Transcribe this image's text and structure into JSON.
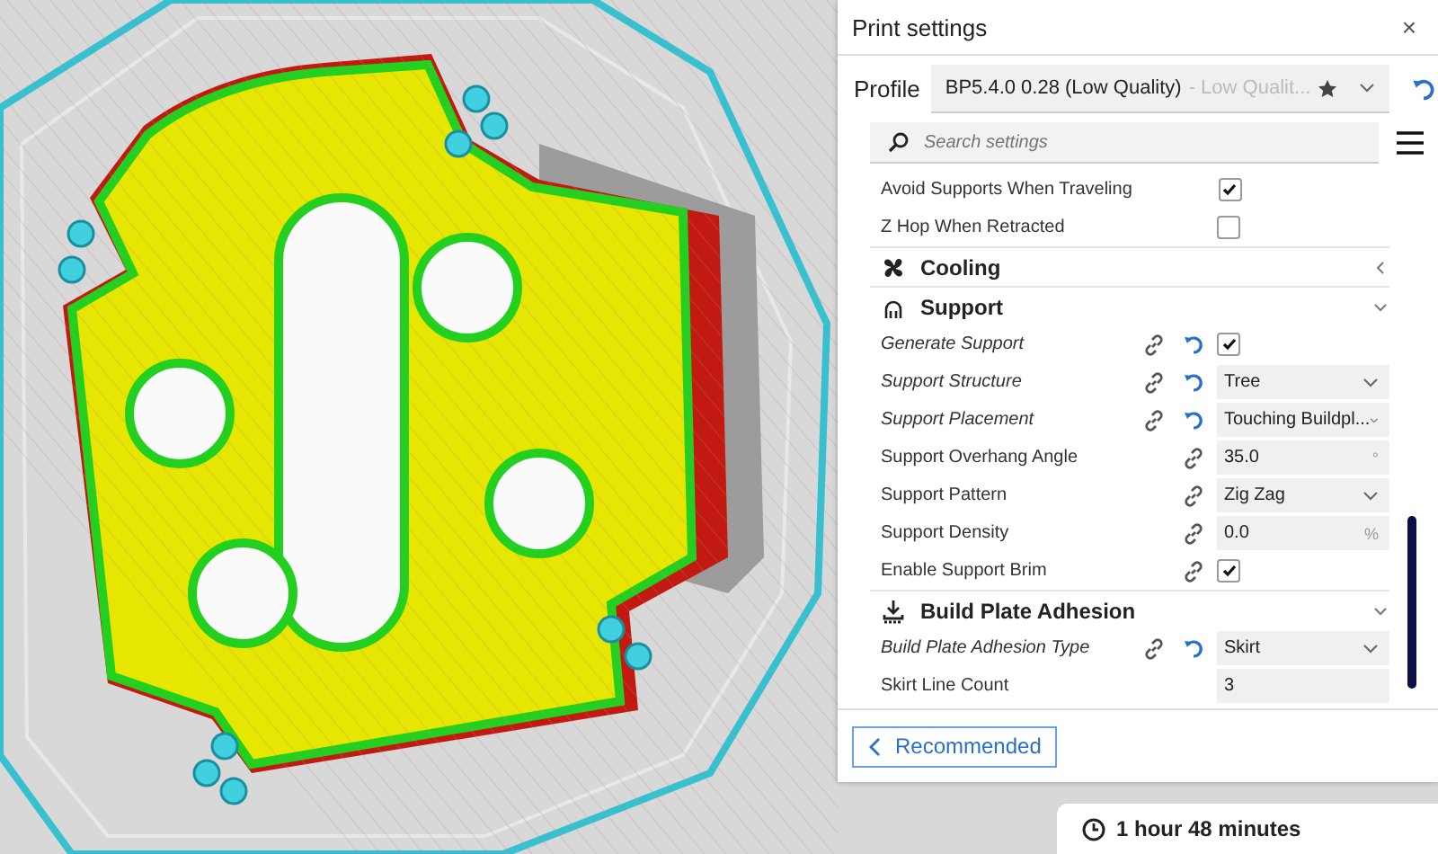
{
  "panel": {
    "title": "Print settings",
    "close": "×"
  },
  "profile": {
    "label": "Profile",
    "value": "BP5.4.0 0.28 (Low Quality)",
    "suffix": "- Low Qualit..."
  },
  "search": {
    "placeholder": "Search settings"
  },
  "settings": [
    {
      "kind": "checkbox",
      "label": "Avoid Supports When Traveling",
      "checked": true,
      "modified": false,
      "linked": false
    },
    {
      "kind": "checkbox",
      "label": "Z Hop When Retracted",
      "checked": false,
      "modified": false,
      "linked": false
    },
    {
      "kind": "section",
      "label": "Cooling",
      "expanded": false
    },
    {
      "kind": "section",
      "label": "Support",
      "expanded": true
    },
    {
      "kind": "checkbox",
      "label": "Generate Support",
      "checked": true,
      "modified": true,
      "linked": true
    },
    {
      "kind": "dropdown",
      "label": "Support Structure",
      "value": "Tree",
      "modified": true,
      "linked": true
    },
    {
      "kind": "dropdown",
      "label": "Support Placement",
      "value": "Touching Buildpl...",
      "modified": true,
      "linked": true
    },
    {
      "kind": "number",
      "label": "Support Overhang Angle",
      "value": "35.0",
      "unit": "°",
      "modified": false,
      "linked": true
    },
    {
      "kind": "dropdown",
      "label": "Support Pattern",
      "value": "Zig Zag",
      "modified": false,
      "linked": true
    },
    {
      "kind": "number",
      "label": "Support Density",
      "value": "0.0",
      "unit": "%",
      "modified": false,
      "linked": true
    },
    {
      "kind": "checkbox",
      "label": "Enable Support Brim",
      "checked": true,
      "modified": false,
      "linked": true
    },
    {
      "kind": "section",
      "label": "Build Plate Adhesion",
      "expanded": true
    },
    {
      "kind": "dropdown",
      "label": "Build Plate Adhesion Type",
      "value": "Skirt",
      "modified": true,
      "linked": true
    },
    {
      "kind": "number",
      "label": "Skirt Line Count",
      "value": "3",
      "modified": false,
      "linked": false
    }
  ],
  "footer": {
    "button": "Recommended"
  },
  "estimate": {
    "time": "1 hour 48 minutes"
  }
}
